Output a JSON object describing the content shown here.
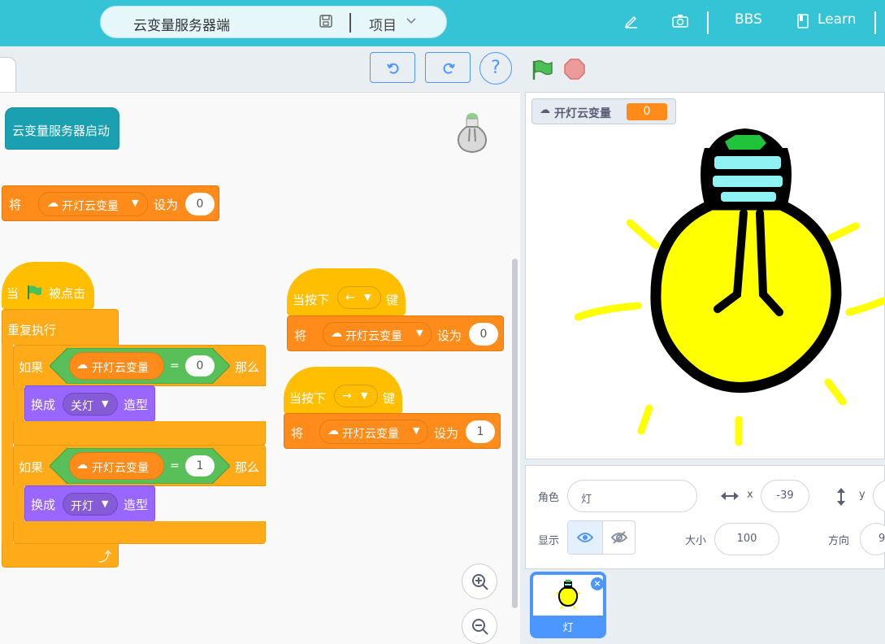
{
  "header": {
    "project_title": "云变量服务器端",
    "project_menu": "项目",
    "bbs": "BBS",
    "learn": "Learn"
  },
  "colors": {
    "accent": "#34c4d5",
    "brand_blue": "#4c97ff",
    "events": "#ffbf00",
    "control": "#ffab19",
    "variables": "#ff8c1a",
    "looks": "#9966ff",
    "operators": "#59c059"
  },
  "code": {
    "hat_server_start": "云变量服务器启动",
    "set_top": {
      "set": "将",
      "var": "开灯云变量",
      "to": "设为",
      "value": "0"
    },
    "flag_script": {
      "when": "当",
      "clicked": "被点击",
      "forever": "重复执行",
      "if1": {
        "if": "如果",
        "var": "开灯云变量",
        "eq": "=",
        "value": "0",
        "then": "那么",
        "switch": "换成",
        "costume": "关灯",
        "costume_suffix": "造型"
      },
      "if2": {
        "if": "如果",
        "var": "开灯云变量",
        "eq": "=",
        "value": "1",
        "then": "那么",
        "switch": "换成",
        "costume": "开灯",
        "costume_suffix": "造型"
      }
    },
    "key_left": {
      "when": "当按下",
      "key": "←",
      "key_suffix": "键",
      "set": "将",
      "var": "开灯云变量",
      "to": "设为",
      "value": "0"
    },
    "key_right": {
      "when": "当按下",
      "key": "→",
      "key_suffix": "键",
      "set": "将",
      "var": "开灯云变量",
      "to": "设为",
      "value": "1"
    }
  },
  "stage": {
    "monitor_label": "开灯云变量",
    "monitor_value": "0"
  },
  "sprite_info": {
    "sprite_label": "角色",
    "sprite_name": "灯",
    "x_label": "x",
    "x_value": "-39",
    "y_label": "y",
    "show_label": "显示",
    "size_label": "大小",
    "size_value": "100",
    "direction_label": "方向",
    "direction_value": "9"
  },
  "sprites": [
    {
      "name": "灯"
    }
  ]
}
